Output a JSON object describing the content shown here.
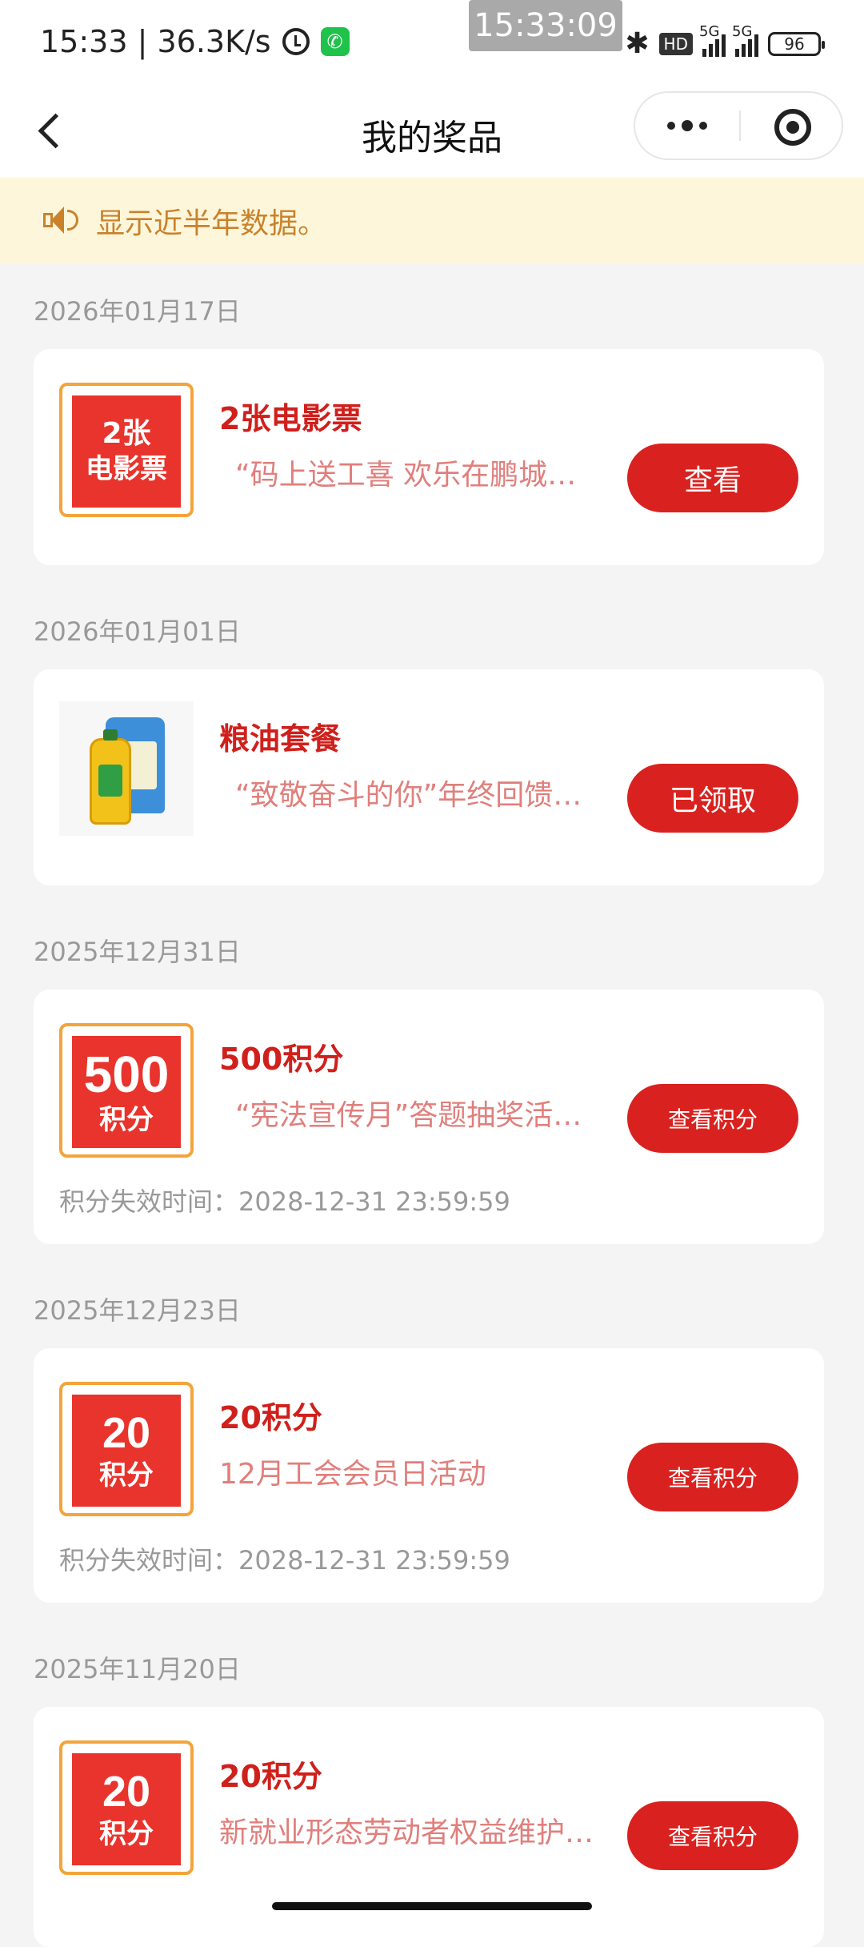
{
  "status_bar": {
    "time_speed": "15:33 | 36.3K/s",
    "overlay_clock": "15:33:09",
    "hd": "HD",
    "network_1": "5G",
    "network_2": "5G",
    "battery": "96"
  },
  "nav": {
    "title": "我的奖品"
  },
  "notice": {
    "text": "显示近半年数据。"
  },
  "prizes": [
    {
      "date": "2026年01月17日",
      "badge_line1": "2张",
      "badge_line2": "电影票",
      "title": "2张电影票",
      "desc": "“码上送工喜 欢乐在鹏城…",
      "button": "查看"
    },
    {
      "date": "2026年01月01日",
      "image_icon": "grain-oil-package-image",
      "title": "粮油套餐",
      "desc": "“致敬奋斗的你”年终回馈…",
      "button": "已领取"
    },
    {
      "date": "2025年12月31日",
      "badge_line1": "500",
      "badge_line2": "积分",
      "title": "500积分",
      "desc": "“宪法宣传月”答题抽奖活…",
      "button": "查看积分",
      "expire": "积分失效时间：2028-12-31 23:59:59"
    },
    {
      "date": "2025年12月23日",
      "badge_line1": "20",
      "badge_line2": "积分",
      "title": "20积分",
      "desc": "12月工会会员日活动",
      "button": "查看积分",
      "expire": "积分失效时间：2028-12-31 23:59:59"
    },
    {
      "date": "2025年11月20日",
      "badge_line1": "20",
      "badge_line2": "积分",
      "title": "20积分",
      "desc": "新就业形态劳动者权益维护…",
      "button": "查看积分"
    }
  ],
  "colors": {
    "accent_red": "#d9221f",
    "title_red": "#d0201c",
    "desc_pink": "#e07f7c",
    "notice_bg": "#fdf6db",
    "notice_text": "#c9822b",
    "badge_border": "#f3a43a"
  }
}
